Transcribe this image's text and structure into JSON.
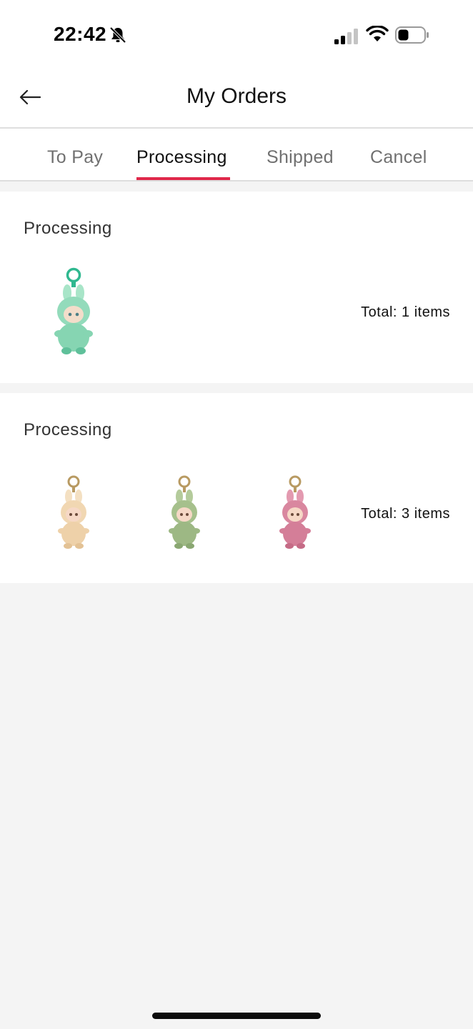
{
  "status_bar": {
    "time": "22:42",
    "icons": [
      "bell-muted-icon",
      "signal-icon",
      "wifi-icon",
      "battery-icon"
    ]
  },
  "header": {
    "title": "My Orders",
    "back_icon": "arrow-left-icon"
  },
  "tabs": [
    {
      "label": "To Pay",
      "active": false
    },
    {
      "label": "Processing",
      "active": true
    },
    {
      "label": "Shipped",
      "active": false
    },
    {
      "label": "Cancel",
      "active": false
    }
  ],
  "accent_color": "#e0284a",
  "orders": [
    {
      "status": "Processing",
      "total": "Total: 1 items",
      "products": [
        {
          "name": "green-plush-keychain-thumb",
          "color": "#8dd9b4"
        }
      ]
    },
    {
      "status": "Processing",
      "total": "Total: 3 items",
      "products": [
        {
          "name": "cream-plush-keychain-thumb",
          "color": "#f1d7b2"
        },
        {
          "name": "sage-plush-keychain-thumb",
          "color": "#a6c08c"
        },
        {
          "name": "pink-plush-keychain-thumb",
          "color": "#d9879f"
        }
      ]
    }
  ]
}
